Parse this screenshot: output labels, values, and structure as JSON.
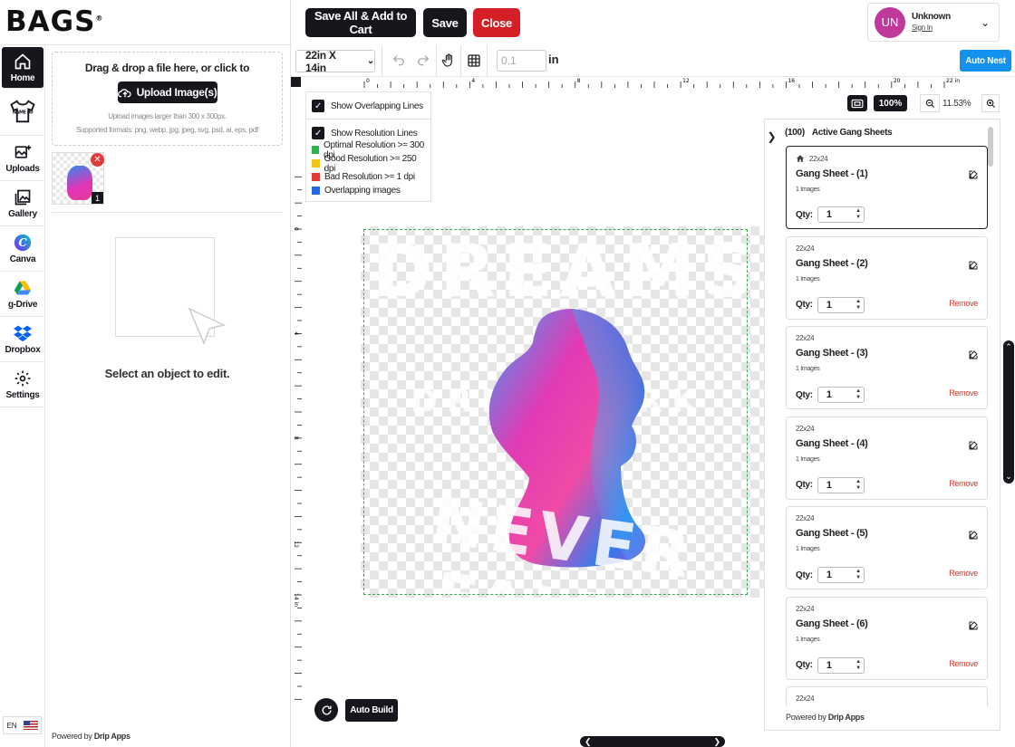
{
  "app": {
    "logo": "BAGS",
    "logo_mark": "®"
  },
  "header": {
    "save_all_label": "Save All & Add to Cart",
    "save_label": "Save",
    "close_label": "Close",
    "user": {
      "initials": "UN",
      "name": "Unknown",
      "sign_in": "Sign In"
    }
  },
  "nav": {
    "items": [
      {
        "label": "Home",
        "icon": "home-icon"
      },
      {
        "label": "",
        "icon": "name-tshirt-icon"
      },
      {
        "label": "Uploads",
        "icon": "upload-image-icon"
      },
      {
        "label": "Gallery",
        "icon": "gallery-icon"
      },
      {
        "label": "Canva",
        "icon": "canva-icon"
      },
      {
        "label": "g-Drive",
        "icon": "google-drive-icon"
      },
      {
        "label": "Dropbox",
        "icon": "dropbox-icon"
      },
      {
        "label": "Settings",
        "icon": "gear-icon"
      }
    ],
    "tshirt_text": "NAME 00",
    "language": "EN"
  },
  "upload_panel": {
    "drop_title": "Drag & drop a file here, or click to",
    "upload_button": "Upload Image(s)",
    "hint_size": "Upload images larger than 300 x 300px.",
    "hint_formats": "Supported formats: png, webp, jpg, jpeg, svg, psd, ai, eps, pdf",
    "thumb_count": "1",
    "select_text": "Select an object to edit.",
    "powered_prefix": "Powered by",
    "powered_brand": "Drip Apps"
  },
  "toolbar": {
    "sheet_size": "22in X 14in",
    "grid_value_placeholder": "0.1",
    "grid_unit": "in",
    "auto_nest_label": "Auto Nest"
  },
  "rulers": {
    "top": [
      "0",
      "4",
      "8",
      "12",
      "16",
      "20",
      "22 in"
    ],
    "left": [
      "0",
      "4",
      "8",
      "12",
      "14 in"
    ]
  },
  "overlay": {
    "show_overlapping": "Show Overlapping Lines",
    "show_resolution": "Show Resolution Lines",
    "legend": [
      {
        "label": "Optimal Resolution >= 300 dpi",
        "color": "#2bb44b"
      },
      {
        "label": "Good Resolution >= 250 dpi",
        "color": "#f0c418"
      },
      {
        "label": "Bad Resolution >= 1 dpi",
        "color": "#e03a3a"
      },
      {
        "label": "Overlapping images",
        "color": "#2769e0"
      }
    ]
  },
  "artwork": {
    "text_top": "DREAMS",
    "text_mid": "DRIP  WORK",
    "text_bottom": "NEVER FALLS"
  },
  "zoom": {
    "preset": "100%",
    "current": "11.53%"
  },
  "canvas_footer": {
    "auto_build": "Auto Build"
  },
  "sheets": {
    "count_label": "(100)",
    "title": "Active Gang Sheets",
    "items": [
      {
        "size": "22x24",
        "name": "Gang Sheet - (1)",
        "images": "1 Images",
        "qty": "1",
        "remove": ""
      },
      {
        "size": "22x24",
        "name": "Gang Sheet - (2)",
        "images": "1 Images",
        "qty": "1",
        "remove": "Remove"
      },
      {
        "size": "22x24",
        "name": "Gang Sheet - (3)",
        "images": "1 Images",
        "qty": "1",
        "remove": "Remove"
      },
      {
        "size": "22x24",
        "name": "Gang Sheet - (4)",
        "images": "1 Images",
        "qty": "1",
        "remove": "Remove"
      },
      {
        "size": "22x24",
        "name": "Gang Sheet - (5)",
        "images": "1 Images",
        "qty": "1",
        "remove": "Remove"
      },
      {
        "size": "22x24",
        "name": "Gang Sheet - (6)",
        "images": "1 Images",
        "qty": "1",
        "remove": "Remove"
      },
      {
        "size": "22x24",
        "name": "",
        "images": "",
        "qty": "",
        "remove": ""
      }
    ],
    "qty_label": "Qty:",
    "powered_prefix": "Powered by",
    "powered_brand": "Drip Apps"
  },
  "colors": {
    "primary": "#16171d",
    "danger": "#d51f27",
    "accent": "#1292ee",
    "avatar": "#c0399a"
  }
}
